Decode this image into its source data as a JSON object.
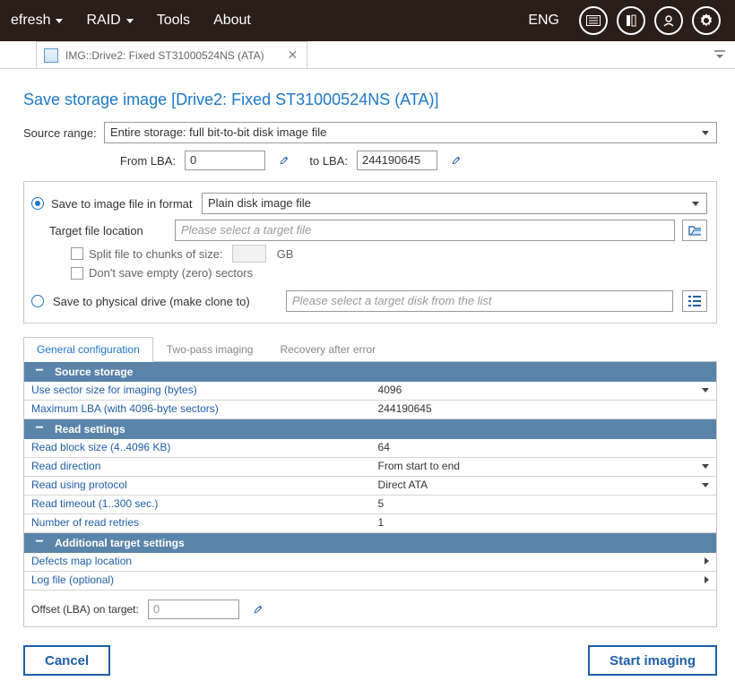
{
  "menubar": {
    "items": [
      {
        "label": "efresh",
        "has_caret": true
      },
      {
        "label": "RAID",
        "has_caret": true
      },
      {
        "label": "Tools",
        "has_caret": false
      },
      {
        "label": "About",
        "has_caret": false
      }
    ],
    "lang": "ENG"
  },
  "tab": {
    "title": "IMG::Drive2: Fixed ST31000524NS (ATA)"
  },
  "page": {
    "title": "Save storage image [Drive2: Fixed ST31000524NS (ATA)]",
    "source_range_label": "Source range:",
    "source_range_value": "Entire storage: full bit-to-bit disk image file",
    "from_lba_label": "From LBA:",
    "from_lba_value": "0",
    "to_lba_label": "to LBA:",
    "to_lba_value": "244190645"
  },
  "target": {
    "save_file_label": "Save to image file in format",
    "format_value": "Plain disk image file",
    "target_file_label": "Target file location",
    "target_file_placeholder": "Please select a target file",
    "split_label": "Split file to chunks of size:",
    "split_unit": "GB",
    "noempty_label": "Don't save empty (zero) sectors",
    "save_phys_label": "Save to physical drive (make clone to)",
    "phys_placeholder": "Please select a target disk from the list"
  },
  "tabs2": [
    "General configuration",
    "Two-pass imaging",
    "Recovery after error"
  ],
  "sections": [
    {
      "title": "Source storage",
      "rows": [
        {
          "l": "Use sector size for imaging (bytes)",
          "r": "4096",
          "caret": "down"
        },
        {
          "l": "Maximum LBA (with 4096-byte sectors)",
          "r": "244190645"
        }
      ]
    },
    {
      "title": "Read settings",
      "rows": [
        {
          "l": "Read block size (4..4096 KB)",
          "r": "64"
        },
        {
          "l": "Read direction",
          "r": "From start to end",
          "caret": "down"
        },
        {
          "l": "Read using protocol",
          "r": "Direct ATA",
          "caret": "down"
        },
        {
          "l": "Read timeout (1..300 sec.)",
          "r": "5"
        },
        {
          "l": "Number of read retries",
          "r": "1"
        }
      ]
    },
    {
      "title": "Additional target settings",
      "rows": [
        {
          "l": "Defects map location",
          "r": "",
          "caret": "right"
        },
        {
          "l": "Log file (optional)",
          "r": "",
          "caret": "right"
        }
      ]
    }
  ],
  "footer": {
    "offset_label": "Offset (LBA) on target:",
    "offset_value": "0"
  },
  "buttons": {
    "cancel": "Cancel",
    "start": "Start imaging"
  }
}
